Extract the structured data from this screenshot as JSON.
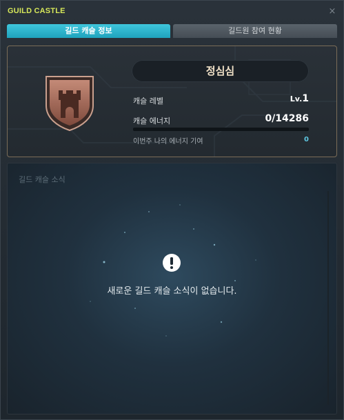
{
  "window": {
    "title": "GUILD CASTLE",
    "close_glyph": "×"
  },
  "tabs": [
    {
      "label": "길드 캐슬 정보",
      "active": true
    },
    {
      "label": "길드원 참여 현황",
      "active": false
    }
  ],
  "castle": {
    "name": "정심심",
    "icon": "castle-crest-icon",
    "level_label": "캐슬 레벨",
    "level_prefix": "Lv.",
    "level_value": "1",
    "energy_label": "캐슬 에너지",
    "energy_value": "0/14286",
    "energy_progress": 0,
    "contribution_label": "이번주 나의 에너지 기여",
    "contribution_value": "0"
  },
  "news": {
    "title": "길드 캐슬 소식",
    "empty_icon": "exclamation-icon",
    "empty_message": "새로운 길드 캐슬 소식이 없습니다."
  },
  "colors": {
    "title": "#d7e85a",
    "active_tab": "#2fb5cf",
    "panel_border": "#7b6d58",
    "crest": "#a0695a",
    "contribution_value": "#5ec6e0"
  }
}
